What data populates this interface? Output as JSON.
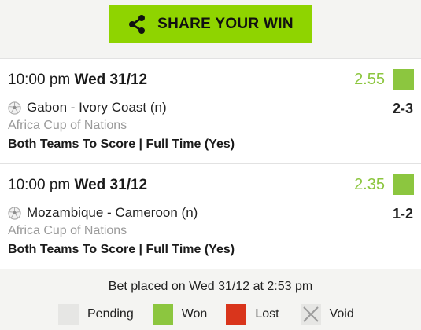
{
  "share": {
    "label": "SHARE YOUR WIN",
    "icon": "share-icon",
    "color": "#8fd400"
  },
  "bets": [
    {
      "time": "10:00 pm",
      "date": "Wed 31/12",
      "odds": "2.55",
      "status": "won",
      "match": "Gabon - Ivory Coast (n)",
      "score": "2-3",
      "league": "Africa Cup of Nations",
      "market": "Both Teams To Score | Full Time (Yes)"
    },
    {
      "time": "10:00 pm",
      "date": "Wed 31/12",
      "odds": "2.35",
      "status": "won",
      "match": "Mozambique - Cameroon (n)",
      "score": "1-2",
      "league": "Africa Cup of Nations",
      "market": "Both Teams To Score | Full Time (Yes)"
    }
  ],
  "footer": {
    "placed": "Bet placed on Wed 31/12 at 2:53 pm",
    "legend": [
      {
        "label": "Pending",
        "color": "#e6e6e4"
      },
      {
        "label": "Won",
        "color": "#8cc63f"
      },
      {
        "label": "Lost",
        "color": "#d9351c"
      },
      {
        "label": "Void",
        "color": "#e6e6e4"
      }
    ]
  },
  "colors": {
    "accent": "#8cc63f",
    "league_text": "#9a9a9a"
  }
}
